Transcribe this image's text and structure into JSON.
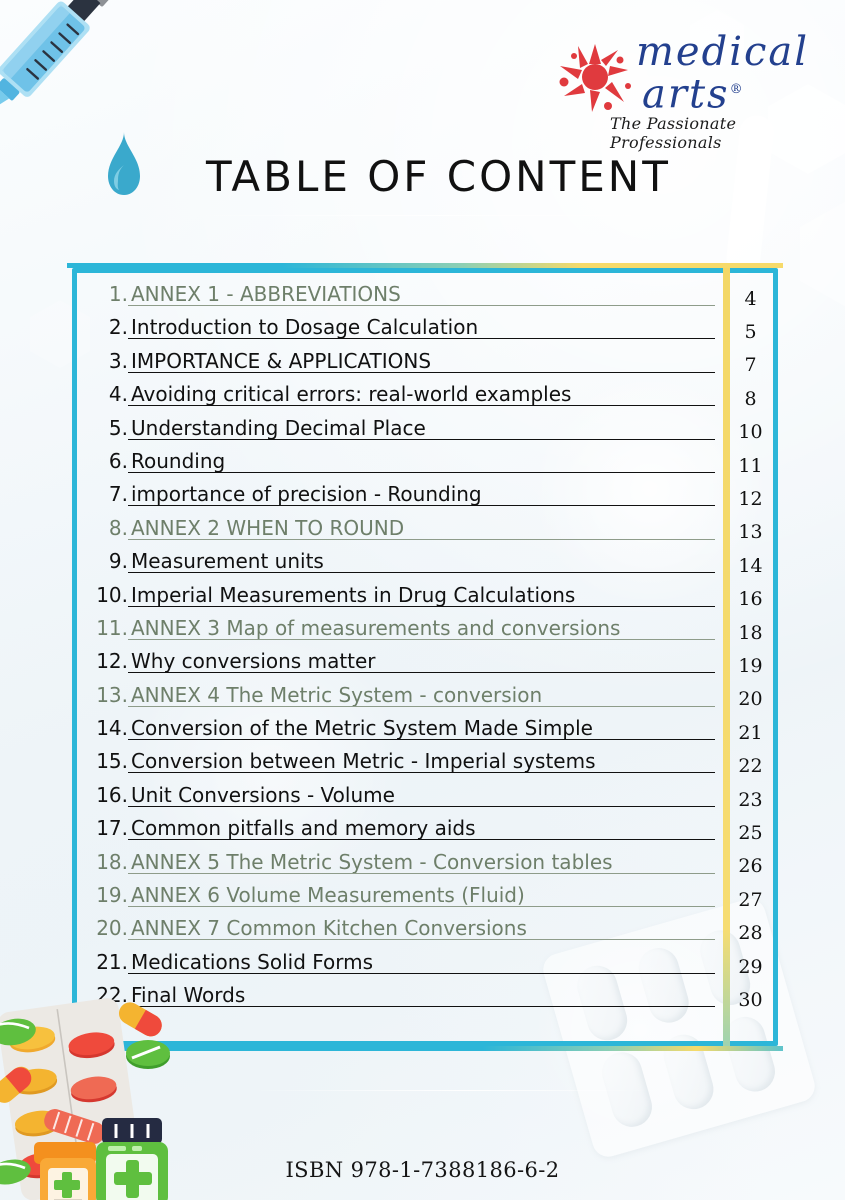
{
  "document": {
    "title": "TABLE OF CONTENT",
    "isbn": "ISBN 978-1-7388186-6-2"
  },
  "logo": {
    "line1": "medical",
    "line2": "arts",
    "registered": "®",
    "tagline": "The Passionate Professionals",
    "splat_color": "#e03a3e",
    "text_color": "#23408e"
  },
  "colors": {
    "frame_cyan": "#2cb6d8",
    "divider_yellow": "#f3d766",
    "annex_text": "#6e7f6a",
    "regular_text": "#111111",
    "background": "#f2f7fa"
  },
  "toc": {
    "entries": [
      {
        "num": "1.",
        "label": "ANNEX 1 - ABBREVIATIONS",
        "page": "4",
        "style": "annex"
      },
      {
        "num": "2.",
        "label": "Introduction to Dosage Calculation",
        "page": "5",
        "style": "regular"
      },
      {
        "num": "3.",
        "label": "IMPORTANCE & APPLICATIONS",
        "page": "7",
        "style": "regular"
      },
      {
        "num": "4.",
        "label": "Avoiding critical errors: real-world examples",
        "page": "8",
        "style": "regular"
      },
      {
        "num": "5.",
        "label": "Understanding Decimal Place",
        "page": "10",
        "style": "regular"
      },
      {
        "num": "6.",
        "label": "Rounding",
        "page": "11",
        "style": "regular"
      },
      {
        "num": "7.",
        "label": "importance of precision - Rounding",
        "page": "12",
        "style": "regular"
      },
      {
        "num": "8.",
        "label": "ANNEX 2 WHEN TO ROUND",
        "page": "13",
        "style": "annex"
      },
      {
        "num": "9.",
        "label": "Measurement units",
        "page": "14",
        "style": "regular"
      },
      {
        "num": "10.",
        "label": "Imperial Measurements in Drug Calculations",
        "page": "16",
        "style": "regular"
      },
      {
        "num": "11.",
        "label": "ANNEX 3 Map of measurements and conversions",
        "page": "18",
        "style": "annex"
      },
      {
        "num": "12.",
        "label": "Why conversions matter",
        "page": "19",
        "style": "regular"
      },
      {
        "num": "13.",
        "label": "ANNEX 4 The Metric System - conversion",
        "page": "20",
        "style": "annex"
      },
      {
        "num": "14.",
        "label": "Conversion of the Metric System Made Simple",
        "page": "21",
        "style": "regular"
      },
      {
        "num": "15.",
        "label": "Conversion between Metric - Imperial systems",
        "page": "22",
        "style": "regular"
      },
      {
        "num": "16.",
        "label": "Unit Conversions - Volume",
        "page": "23",
        "style": "regular"
      },
      {
        "num": "17.",
        "label": "Common pitfalls and memory aids",
        "page": "25",
        "style": "regular"
      },
      {
        "num": "18.",
        "label": "ANNEX 5 The Metric System - Conversion tables",
        "page": "26",
        "style": "annex"
      },
      {
        "num": "19.",
        "label": "ANNEX 6 Volume Measurements (Fluid)",
        "page": "27",
        "style": "annex"
      },
      {
        "num": "20.",
        "label": "ANNEX 7 Common Kitchen Conversions",
        "page": "28",
        "style": "annex"
      },
      {
        "num": "21.",
        "label": "Medications Solid Forms",
        "page": "29",
        "style": "regular"
      },
      {
        "num": "22.",
        "label": "Final Words",
        "page": "30",
        "style": "regular"
      }
    ]
  },
  "illustrations": {
    "top_left": "syringe-with-droplet-icon",
    "bottom_left": "pills-and-medicine-bottles-icon",
    "bottom_right": "blister-pack-watermark"
  }
}
